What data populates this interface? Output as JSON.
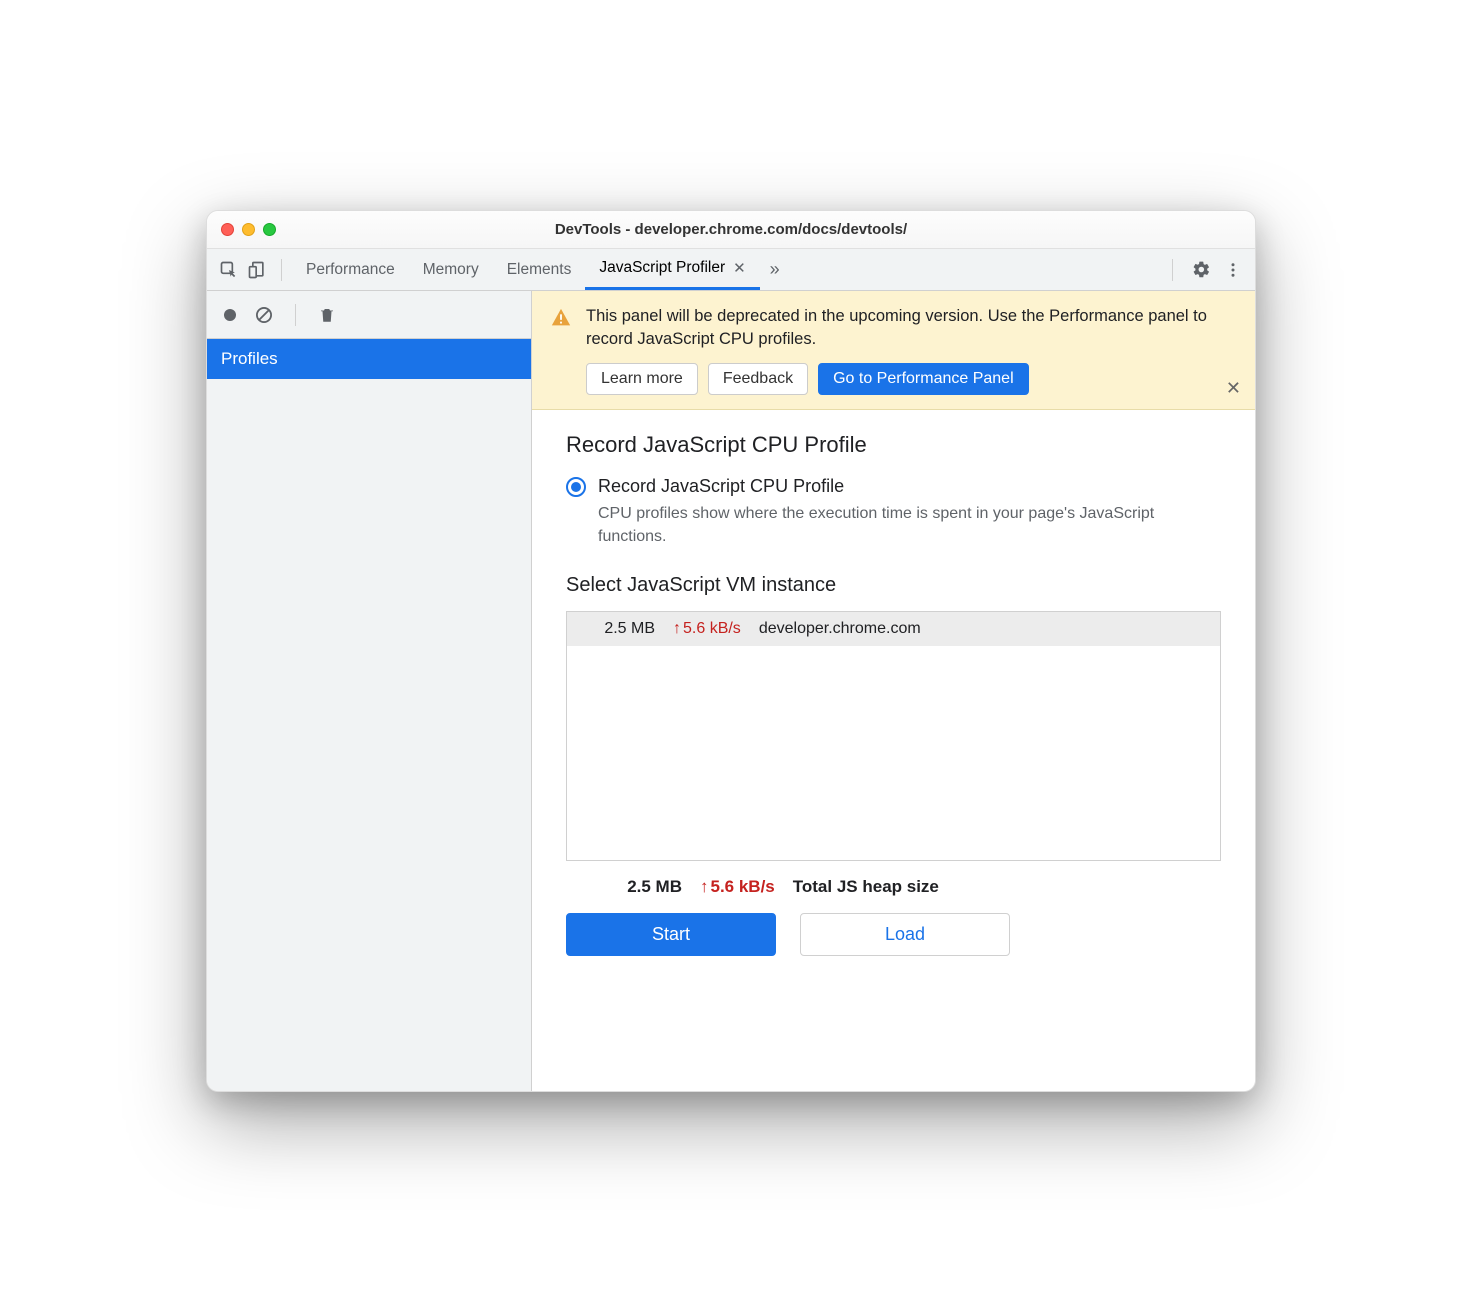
{
  "window": {
    "title": "DevTools - developer.chrome.com/docs/devtools/"
  },
  "tabs": {
    "items": [
      "Performance",
      "Memory",
      "Elements",
      "JavaScript Profiler"
    ],
    "activeIndex": 3
  },
  "sidebar": {
    "profiles_label": "Profiles"
  },
  "banner": {
    "message": "This panel will be deprecated in the upcoming version. Use the Performance panel to record JavaScript CPU profiles.",
    "learn_more": "Learn more",
    "feedback": "Feedback",
    "goto": "Go to Performance Panel"
  },
  "panel": {
    "heading": "Record JavaScript CPU Profile",
    "radio_label": "Record JavaScript CPU Profile",
    "description": "CPU profiles show where the execution time is spent in your page's JavaScript functions.",
    "vm_heading": "Select JavaScript VM instance",
    "vm": {
      "size": "2.5 MB",
      "rate": "5.6 kB/s",
      "host": "developer.chrome.com"
    },
    "totals": {
      "size": "2.5 MB",
      "rate": "5.6 kB/s",
      "label": "Total JS heap size"
    },
    "start": "Start",
    "load": "Load"
  }
}
